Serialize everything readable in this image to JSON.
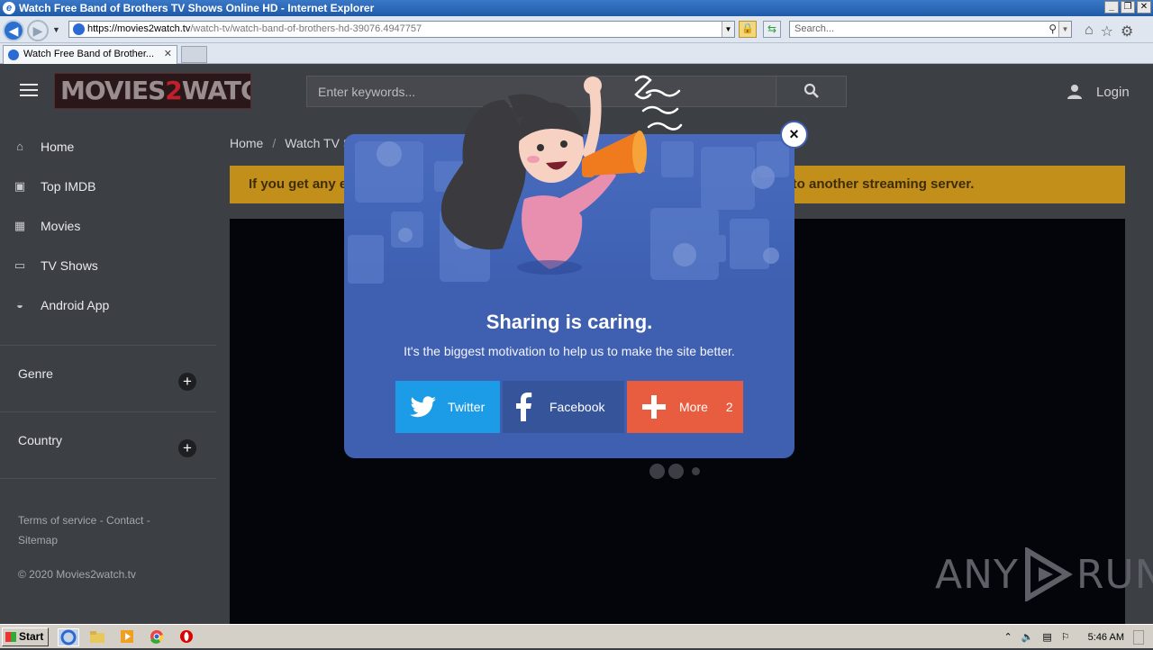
{
  "window": {
    "title": "Watch Free Band of Brothers TV Shows Online HD - Internet Explorer",
    "url_host": "https://movies2watch.tv",
    "url_path": "/watch-tv/watch-band-of-brothers-hd-39076.4947757",
    "search_placeholder": "Search...",
    "tab_title": "Watch Free Band of Brother..."
  },
  "site": {
    "logo_left": "MOVIES",
    "logo_mid": "2",
    "logo_right": "WATCH",
    "search_placeholder": "Enter keywords...",
    "login_label": "Login",
    "nav": [
      {
        "label": "Home",
        "icon": "home-icon"
      },
      {
        "label": "Top IMDB",
        "icon": "imdb-icon"
      },
      {
        "label": "Movies",
        "icon": "film-icon"
      },
      {
        "label": "TV Shows",
        "icon": "tv-icon"
      },
      {
        "label": "Android App",
        "icon": "android-icon"
      }
    ],
    "groups": [
      {
        "label": "Genre"
      },
      {
        "label": "Country"
      }
    ],
    "footer_links": [
      "Terms of service",
      "Contact",
      "Sitemap"
    ],
    "copyright": "© 2020 Movies2watch.tv",
    "breadcrumb": [
      "Home",
      "Watch TV S"
    ],
    "notice_start": "If you get any e",
    "notice_end": "ch to another streaming server.",
    "watermark": {
      "left": "ANY",
      "right": "RUN"
    }
  },
  "modal": {
    "title": "Sharing is caring.",
    "subtitle": "It's the biggest motivation to help us to make the site better.",
    "buttons": [
      {
        "label": "Twitter",
        "icon": "twitter-icon",
        "color": "#1c9ce6"
      },
      {
        "label": "Facebook",
        "icon": "facebook-icon",
        "color": "#36549a"
      },
      {
        "label": "More",
        "icon": "plus-icon",
        "color": "#e85d3f",
        "count": "2"
      }
    ],
    "close_label": "×"
  },
  "taskbar": {
    "start_label": "Start",
    "clock": "5:46 AM"
  }
}
